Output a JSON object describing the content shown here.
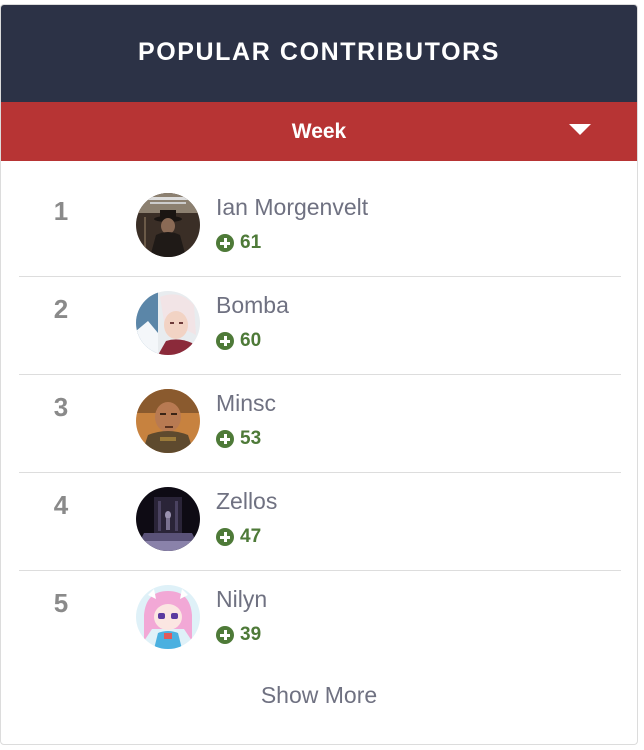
{
  "widget": {
    "title": "POPULAR CONTRIBUTORS",
    "period": {
      "selected": "Week"
    },
    "show_more_label": "Show More"
  },
  "contributors": [
    {
      "rank": "1",
      "name": "Ian Morgenvelt",
      "score": "61"
    },
    {
      "rank": "2",
      "name": "Bomba",
      "score": "60"
    },
    {
      "rank": "3",
      "name": "Minsc",
      "score": "53"
    },
    {
      "rank": "4",
      "name": "Zellos",
      "score": "47"
    },
    {
      "rank": "5",
      "name": "Nilyn",
      "score": "39"
    }
  ],
  "colors": {
    "header_bg": "#2c3246",
    "period_bar_bg": "#b73434",
    "reputation_green": "#4e7a38",
    "name_text": "#6f7181",
    "rank_text": "#8a8a8a"
  },
  "icons": {
    "period_dropdown": "chevron-down-icon",
    "reputation": "plus-circle-icon"
  }
}
